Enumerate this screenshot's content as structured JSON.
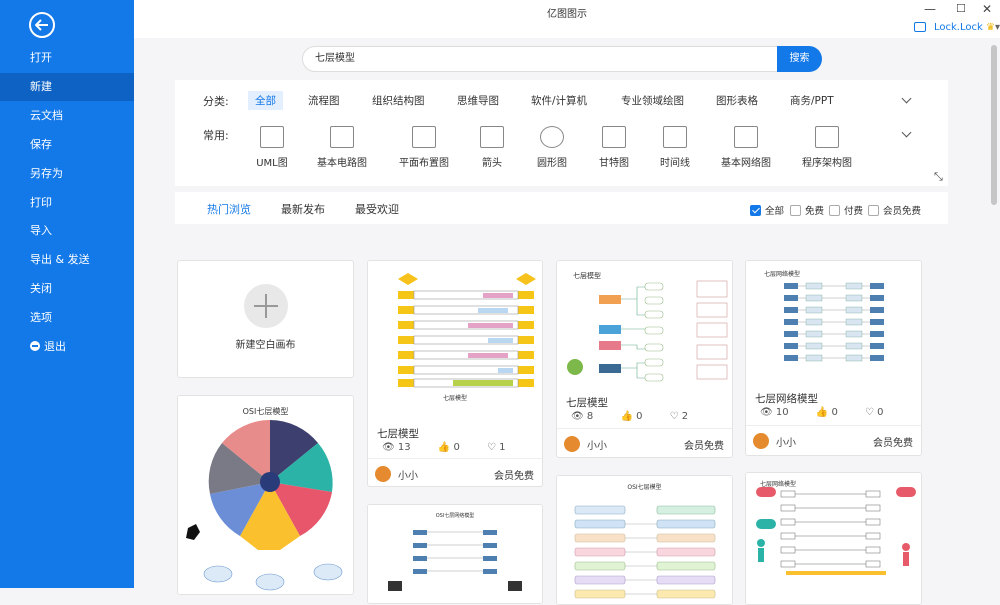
{
  "window": {
    "title": "亿图图示",
    "user": "Lock.Lock"
  },
  "sidebar": {
    "items": [
      "打开",
      "新建",
      "云文档",
      "保存",
      "另存为",
      "打印",
      "导入",
      "导出 & 发送",
      "关闭",
      "选项",
      "退出"
    ],
    "active_index": 1
  },
  "search": {
    "value": "七层模型",
    "button": "搜索"
  },
  "categories": {
    "label": "分类:",
    "items": [
      "全部",
      "流程图",
      "组织结构图",
      "思维导图",
      "软件/计算机",
      "专业领域绘图",
      "图形表格",
      "商务/PPT"
    ]
  },
  "common": {
    "label": "常用:",
    "items": [
      "UML图",
      "基本电路图",
      "平面布置图",
      "箭头",
      "圆形图",
      "甘特图",
      "时间线",
      "基本网络图",
      "程序架构图"
    ]
  },
  "tabs": [
    "热门浏览",
    "最新发布",
    "最受欢迎"
  ],
  "filters": [
    "全部",
    "免费",
    "付费",
    "会员免费"
  ],
  "new_canvas": "新建空白画布",
  "cards": [
    {
      "thumb_title": "七层模型",
      "title": "七层模型",
      "views": "13",
      "likes": "0",
      "favs": "1",
      "author": "小小",
      "price": "会员免费"
    },
    {
      "thumb_title": "七层模型",
      "title": "七层模型",
      "views": "8",
      "likes": "0",
      "favs": "2",
      "author": "小小",
      "price": "会员免费"
    },
    {
      "thumb_title": "七层网络模型",
      "title": "七层网络模型",
      "views": "10",
      "likes": "0",
      "favs": "0",
      "author": "小小",
      "price": "会员免费"
    },
    {
      "thumb_title": "OSI七层模型"
    },
    {
      "thumb_title": "OSI七层网络模型"
    },
    {
      "thumb_title": "OSI七层模型"
    },
    {
      "thumb_title": "七层网络模型"
    }
  ]
}
